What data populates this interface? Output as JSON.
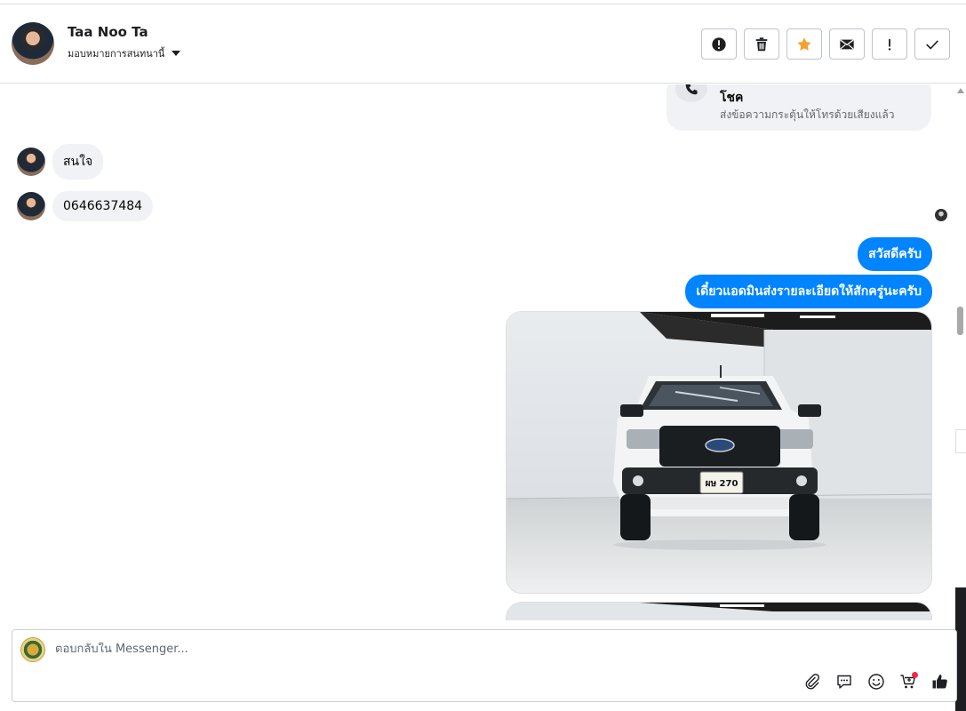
{
  "header": {
    "contact_name": "Taa Noo Ta",
    "assign_label": "มอบหมายการสนทนานี้",
    "actions": [
      {
        "name": "report-spam-button",
        "icon": "alert-circle-icon"
      },
      {
        "name": "delete-button",
        "icon": "trash-icon"
      },
      {
        "name": "star-button",
        "icon": "star-icon"
      },
      {
        "name": "mark-unread-button",
        "icon": "envelope-icon"
      },
      {
        "name": "follow-up-button",
        "icon": "exclamation-icon"
      },
      {
        "name": "mark-done-button",
        "icon": "check-icon"
      }
    ],
    "star_color": "#f5a02a"
  },
  "chat": {
    "call_card": {
      "title": "โชค",
      "subtitle": "ส่งข้อความกระตุ้นให้โทรด้วยเสียงแล้ว"
    },
    "incoming": [
      {
        "text": "สนใจ"
      },
      {
        "text": "0646637484"
      }
    ],
    "outgoing": [
      {
        "text": "สวัสดีครับ"
      },
      {
        "text": "เดี๋ยวแอดมินส่งรายละเอียดให้สักครู่นะครับ"
      }
    ],
    "photo": {
      "plate_text": "ผษ 270"
    },
    "outgoing_color": "#0084ff"
  },
  "composer": {
    "placeholder": "ตอบกลับใน Messenger...",
    "tools": [
      "paperclip-icon",
      "saved-reply-icon",
      "emoji-icon",
      "cart-icon",
      "thumbs-up-icon"
    ]
  }
}
